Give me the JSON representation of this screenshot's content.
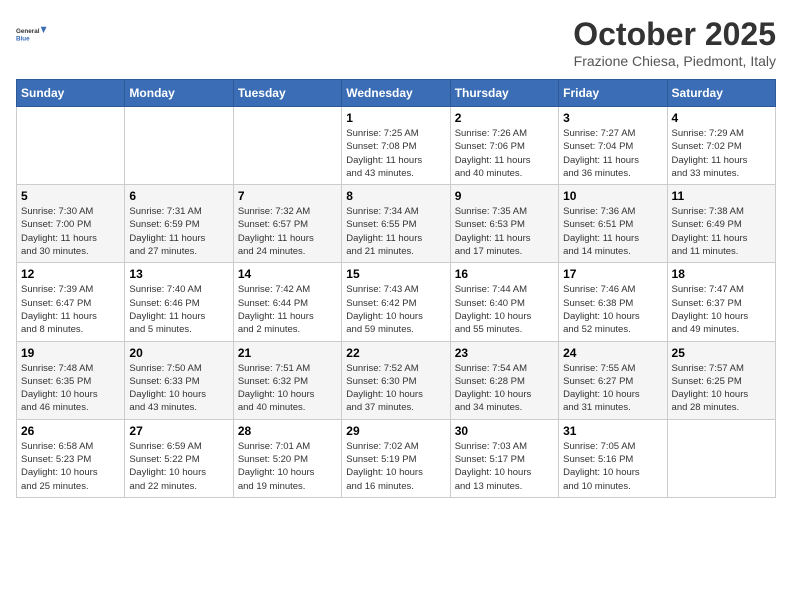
{
  "header": {
    "logo_line1": "General",
    "logo_line2": "Blue",
    "month": "October 2025",
    "location": "Frazione Chiesa, Piedmont, Italy"
  },
  "weekdays": [
    "Sunday",
    "Monday",
    "Tuesday",
    "Wednesday",
    "Thursday",
    "Friday",
    "Saturday"
  ],
  "weeks": [
    [
      {
        "day": "",
        "info": ""
      },
      {
        "day": "",
        "info": ""
      },
      {
        "day": "",
        "info": ""
      },
      {
        "day": "1",
        "info": "Sunrise: 7:25 AM\nSunset: 7:08 PM\nDaylight: 11 hours\nand 43 minutes."
      },
      {
        "day": "2",
        "info": "Sunrise: 7:26 AM\nSunset: 7:06 PM\nDaylight: 11 hours\nand 40 minutes."
      },
      {
        "day": "3",
        "info": "Sunrise: 7:27 AM\nSunset: 7:04 PM\nDaylight: 11 hours\nand 36 minutes."
      },
      {
        "day": "4",
        "info": "Sunrise: 7:29 AM\nSunset: 7:02 PM\nDaylight: 11 hours\nand 33 minutes."
      }
    ],
    [
      {
        "day": "5",
        "info": "Sunrise: 7:30 AM\nSunset: 7:00 PM\nDaylight: 11 hours\nand 30 minutes."
      },
      {
        "day": "6",
        "info": "Sunrise: 7:31 AM\nSunset: 6:59 PM\nDaylight: 11 hours\nand 27 minutes."
      },
      {
        "day": "7",
        "info": "Sunrise: 7:32 AM\nSunset: 6:57 PM\nDaylight: 11 hours\nand 24 minutes."
      },
      {
        "day": "8",
        "info": "Sunrise: 7:34 AM\nSunset: 6:55 PM\nDaylight: 11 hours\nand 21 minutes."
      },
      {
        "day": "9",
        "info": "Sunrise: 7:35 AM\nSunset: 6:53 PM\nDaylight: 11 hours\nand 17 minutes."
      },
      {
        "day": "10",
        "info": "Sunrise: 7:36 AM\nSunset: 6:51 PM\nDaylight: 11 hours\nand 14 minutes."
      },
      {
        "day": "11",
        "info": "Sunrise: 7:38 AM\nSunset: 6:49 PM\nDaylight: 11 hours\nand 11 minutes."
      }
    ],
    [
      {
        "day": "12",
        "info": "Sunrise: 7:39 AM\nSunset: 6:47 PM\nDaylight: 11 hours\nand 8 minutes."
      },
      {
        "day": "13",
        "info": "Sunrise: 7:40 AM\nSunset: 6:46 PM\nDaylight: 11 hours\nand 5 minutes."
      },
      {
        "day": "14",
        "info": "Sunrise: 7:42 AM\nSunset: 6:44 PM\nDaylight: 11 hours\nand 2 minutes."
      },
      {
        "day": "15",
        "info": "Sunrise: 7:43 AM\nSunset: 6:42 PM\nDaylight: 10 hours\nand 59 minutes."
      },
      {
        "day": "16",
        "info": "Sunrise: 7:44 AM\nSunset: 6:40 PM\nDaylight: 10 hours\nand 55 minutes."
      },
      {
        "day": "17",
        "info": "Sunrise: 7:46 AM\nSunset: 6:38 PM\nDaylight: 10 hours\nand 52 minutes."
      },
      {
        "day": "18",
        "info": "Sunrise: 7:47 AM\nSunset: 6:37 PM\nDaylight: 10 hours\nand 49 minutes."
      }
    ],
    [
      {
        "day": "19",
        "info": "Sunrise: 7:48 AM\nSunset: 6:35 PM\nDaylight: 10 hours\nand 46 minutes."
      },
      {
        "day": "20",
        "info": "Sunrise: 7:50 AM\nSunset: 6:33 PM\nDaylight: 10 hours\nand 43 minutes."
      },
      {
        "day": "21",
        "info": "Sunrise: 7:51 AM\nSunset: 6:32 PM\nDaylight: 10 hours\nand 40 minutes."
      },
      {
        "day": "22",
        "info": "Sunrise: 7:52 AM\nSunset: 6:30 PM\nDaylight: 10 hours\nand 37 minutes."
      },
      {
        "day": "23",
        "info": "Sunrise: 7:54 AM\nSunset: 6:28 PM\nDaylight: 10 hours\nand 34 minutes."
      },
      {
        "day": "24",
        "info": "Sunrise: 7:55 AM\nSunset: 6:27 PM\nDaylight: 10 hours\nand 31 minutes."
      },
      {
        "day": "25",
        "info": "Sunrise: 7:57 AM\nSunset: 6:25 PM\nDaylight: 10 hours\nand 28 minutes."
      }
    ],
    [
      {
        "day": "26",
        "info": "Sunrise: 6:58 AM\nSunset: 5:23 PM\nDaylight: 10 hours\nand 25 minutes."
      },
      {
        "day": "27",
        "info": "Sunrise: 6:59 AM\nSunset: 5:22 PM\nDaylight: 10 hours\nand 22 minutes."
      },
      {
        "day": "28",
        "info": "Sunrise: 7:01 AM\nSunset: 5:20 PM\nDaylight: 10 hours\nand 19 minutes."
      },
      {
        "day": "29",
        "info": "Sunrise: 7:02 AM\nSunset: 5:19 PM\nDaylight: 10 hours\nand 16 minutes."
      },
      {
        "day": "30",
        "info": "Sunrise: 7:03 AM\nSunset: 5:17 PM\nDaylight: 10 hours\nand 13 minutes."
      },
      {
        "day": "31",
        "info": "Sunrise: 7:05 AM\nSunset: 5:16 PM\nDaylight: 10 hours\nand 10 minutes."
      },
      {
        "day": "",
        "info": ""
      }
    ]
  ]
}
